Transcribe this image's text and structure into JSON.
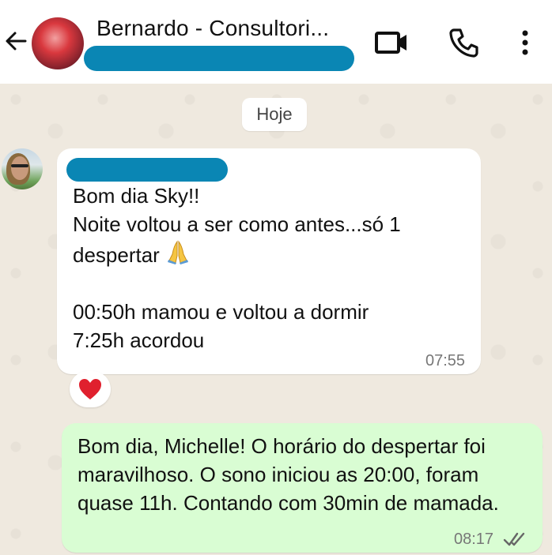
{
  "header": {
    "contact_name": "Bernardo - Consultori...",
    "icons": [
      "back-arrow-icon",
      "video-call-icon",
      "voice-call-icon",
      "more-options-icon"
    ]
  },
  "chat": {
    "date_chip": "Hoje",
    "incoming": {
      "text_lines": [
        "Bom dia Sky!!",
        "Noite voltou a ser como antes...só 1",
        "despertar"
      ],
      "text_lines_2": [
        "00:50h mamou e voltou a dormir",
        "7:25h acordou"
      ],
      "time": "07:55",
      "emoji": "folded-hands-icon",
      "reaction": "red-heart-icon"
    },
    "outgoing": {
      "text": "Bom dia, Michelle! O horário do despertar foi maravilhoso. O sono iniciou as 20:00, foram quase 11h. Contando com 30min de mamada.",
      "time": "08:17",
      "status_icon": "double-check-icon"
    }
  },
  "colors": {
    "redaction": "#0a86b4",
    "outgoing_bubble": "#d9fdd3",
    "incoming_bubble": "#ffffff",
    "background": "#efe9df"
  }
}
